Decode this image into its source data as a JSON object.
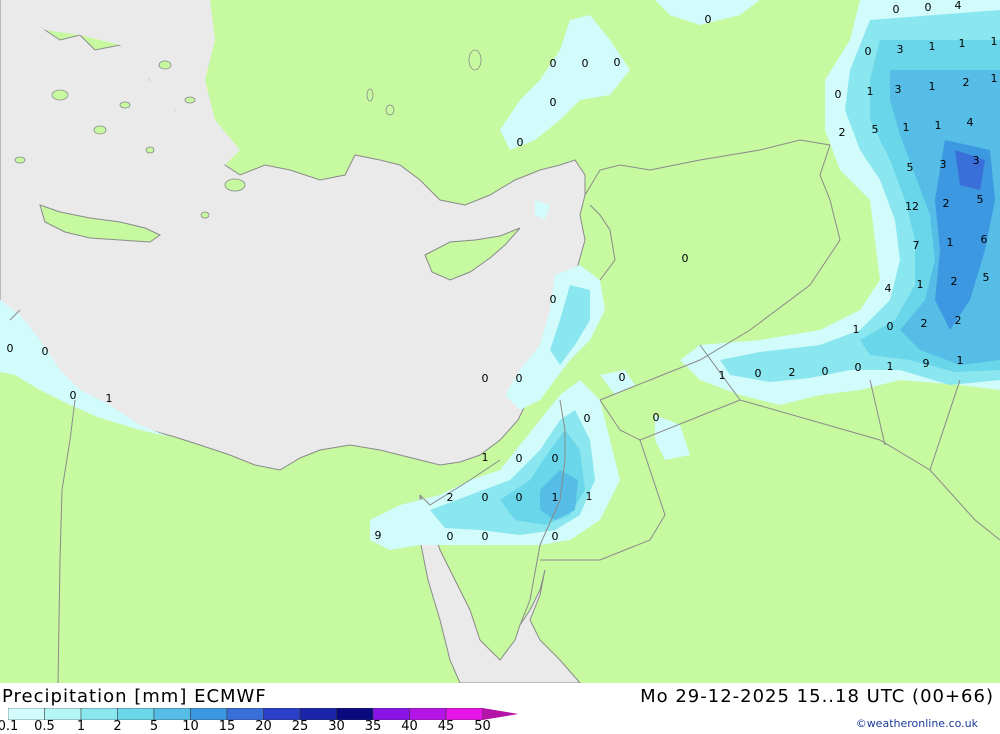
{
  "title": "Precipitation [mm] ECMWF",
  "valid_time": "Mo 29-12-2025 15..18 UTC (00+66)",
  "credit": "©weatheronline.co.uk",
  "colors": {
    "land": "#c6f9a0",
    "sea": "#eaeaea",
    "border": "#8a8a8a"
  },
  "legend": {
    "labels": [
      "0.1",
      "0.5",
      "1",
      "2",
      "5",
      "10",
      "15",
      "20",
      "25",
      "30",
      "35",
      "40",
      "45",
      "50"
    ],
    "colors": [
      "#d2fbfb",
      "#b4f5f5",
      "#8ae6ef",
      "#6ad6ea",
      "#55bde6",
      "#3c98e0",
      "#3a6fd9",
      "#2a40c8",
      "#1a24a8",
      "#0a0a80",
      "#8a14e8",
      "#b414e6",
      "#e614e6",
      "#d214c8",
      "#b414a8"
    ]
  },
  "map_values": [
    "0",
    "0",
    "4",
    "3",
    "1",
    "1",
    "1",
    "0",
    "3",
    "1",
    "0",
    "1",
    "2",
    "1",
    "2",
    "5",
    "1",
    "1",
    "4",
    "5",
    "3",
    "3",
    "12",
    "2",
    "5",
    "7",
    "1",
    "6",
    "4",
    "1",
    "2",
    "5",
    "1",
    "0",
    "2",
    "2",
    "9",
    "1",
    "1",
    "0",
    "0",
    "2",
    "0",
    "1",
    "0",
    "0",
    "0",
    "0",
    "0",
    "0",
    "0",
    "0",
    "0",
    "0",
    "0",
    "1",
    "0",
    "0",
    "0",
    "0",
    "0",
    "0",
    "0",
    "1",
    "2",
    "0",
    "0",
    "1",
    "1",
    "9",
    "0",
    "0",
    "0",
    "1",
    "0"
  ]
}
